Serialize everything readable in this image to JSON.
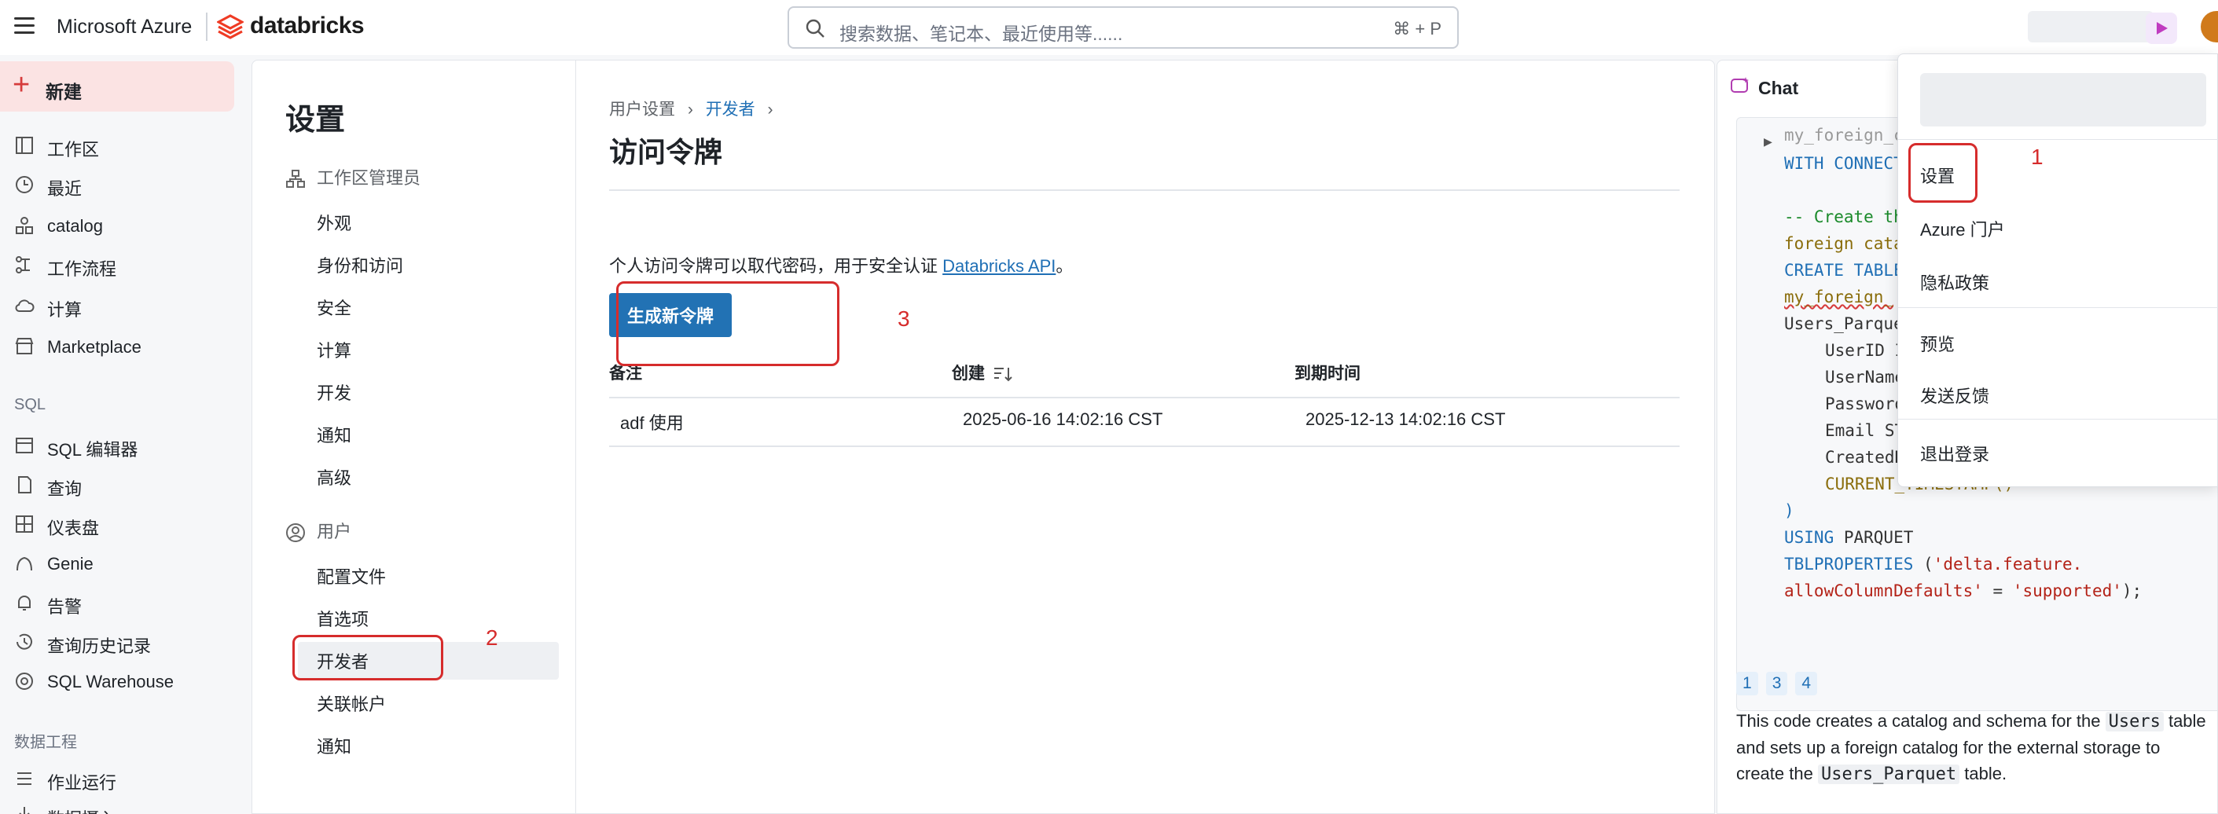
{
  "topbar": {
    "brand_azure": "Microsoft Azure",
    "brand_databricks": "databricks",
    "search_placeholder": "搜索数据、笔记本、最近使用等......",
    "search_shortcut": "⌘ + P"
  },
  "leftnav": {
    "new_label": "新建",
    "items": [
      {
        "label": "工作区",
        "icon": "workspace-icon"
      },
      {
        "label": "最近",
        "icon": "clock-icon"
      },
      {
        "label": "catalog",
        "icon": "catalog-icon"
      },
      {
        "label": "工作流程",
        "icon": "workflow-icon"
      },
      {
        "label": "计算",
        "icon": "cloud-icon"
      },
      {
        "label": "Marketplace",
        "icon": "store-icon"
      }
    ],
    "sql_section": "SQL",
    "sql_items": [
      {
        "label": "SQL 编辑器",
        "icon": "sql-editor-icon"
      },
      {
        "label": "查询",
        "icon": "query-icon"
      },
      {
        "label": "仪表盘",
        "icon": "dashboard-icon"
      },
      {
        "label": "Genie",
        "icon": "genie-icon"
      },
      {
        "label": "告警",
        "icon": "bell-icon"
      },
      {
        "label": "查询历史记录",
        "icon": "history-icon"
      },
      {
        "label": "SQL Warehouse",
        "icon": "warehouse-icon"
      }
    ],
    "data_section": "数据工程",
    "data_items": [
      {
        "label": "作业运行",
        "icon": "job-runs-icon"
      },
      {
        "label": "数据摄入",
        "icon": "ingest-icon"
      }
    ]
  },
  "settings": {
    "title": "设置",
    "group_admin": "工作区管理员",
    "admin_items": [
      "外观",
      "身份和访问",
      "安全",
      "计算",
      "开发",
      "通知",
      "高级"
    ],
    "group_user": "用户",
    "user_items": [
      "配置文件",
      "首选项",
      "开发者",
      "关联帐户",
      "通知"
    ],
    "active_item": "开发者"
  },
  "main": {
    "breadcrumb_1": "用户设置",
    "breadcrumb_2": "开发者",
    "breadcrumb_sep": "›",
    "page_title": "访问令牌",
    "description_prefix": "个人访问令牌可以取代密码，用于安全认证 ",
    "description_link": "Databricks API",
    "description_suffix": "。",
    "generate_button": "生成新令牌",
    "table": {
      "headers": [
        "备注",
        "创建",
        "到期时间"
      ],
      "rows": [
        {
          "comment": "adf 使用",
          "created": "2025-06-16 14:02:16 CST",
          "expires": "2025-12-13 14:02:16 CST"
        }
      ]
    }
  },
  "chat": {
    "title": "Chat",
    "refs": [
      "1",
      "3",
      "4"
    ],
    "text_1": "This code creates a catalog and schema for the ",
    "text_code_1": "Users",
    "text_2": " table and sets up a foreign catalog for the external storage to create the ",
    "text_code_2": "Users_Parquet",
    "text_3": " table."
  },
  "dropdown": {
    "items": [
      "设置",
      "Azure 门户",
      "隐私政策",
      "预览",
      "发送反馈",
      "退出登录"
    ]
  },
  "annotations": [
    "1",
    "2",
    "3"
  ],
  "colors": {
    "accent": "#2272b4",
    "new_button_bg": "#fbe3e3",
    "annotation": "#d62c2c"
  }
}
